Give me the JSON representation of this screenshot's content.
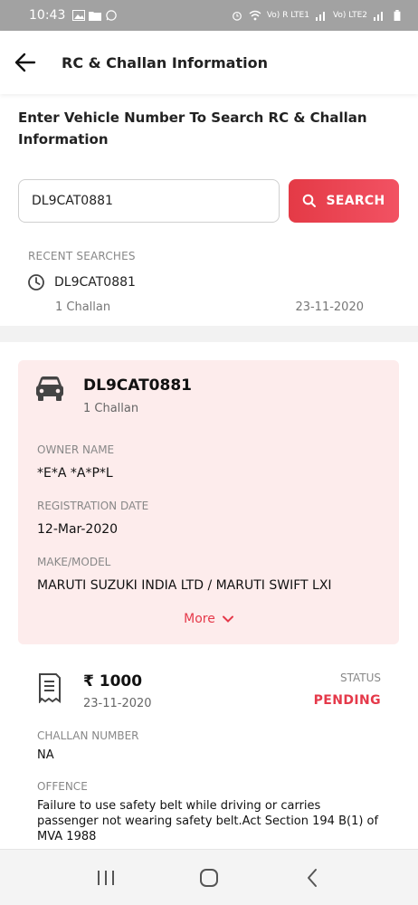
{
  "status_bar": {
    "time": "10:43",
    "network_label_1": "Vo) R LTE1",
    "network_label_2": "Vo) LTE2"
  },
  "app_bar": {
    "title": "RC & Challan Information"
  },
  "search": {
    "prompt": "Enter Vehicle Number To Search RC & Challan Information",
    "value": "DL9CAT0881",
    "button_label": "SEARCH"
  },
  "recent": {
    "label": "RECENT SEARCHES",
    "items": [
      {
        "reg": "DL9CAT0881",
        "challans": "1 Challan",
        "date": "23-11-2020"
      }
    ]
  },
  "rc": {
    "reg": "DL9CAT0881",
    "challans": "1 Challan",
    "fields": [
      {
        "label": "OWNER NAME",
        "value": "*E*A *A*P*L"
      },
      {
        "label": "REGISTRATION DATE",
        "value": "12-Mar-2020"
      },
      {
        "label": "MAKE/MODEL",
        "value": "MARUTI SUZUKI INDIA LTD / MARUTI SWIFT LXI"
      }
    ],
    "more_label": "More"
  },
  "challan": {
    "amount": "₹ 1000",
    "date": "23-11-2020",
    "status_label": "STATUS",
    "status_value": "PENDING",
    "number_label": "CHALLAN NUMBER",
    "number_value": "NA",
    "offence_label": "OFFENCE",
    "offence_value": "Failure to use safety belt while driving or carries passenger not wearing safety belt.Act Section 194 B(1) of MVA 1988"
  },
  "colors": {
    "accent": "#e5394a",
    "card_bg": "#fdecec",
    "status_bar": "#a2a2a2"
  },
  "icons": {
    "back": "arrow-left-icon",
    "search": "search-icon",
    "recent": "clock-icon",
    "vehicle": "car-icon",
    "challan": "receipt-icon",
    "more": "chevron-down-icon",
    "nav_recents": "recents-icon",
    "nav_home": "home-icon",
    "nav_back": "back-icon"
  }
}
